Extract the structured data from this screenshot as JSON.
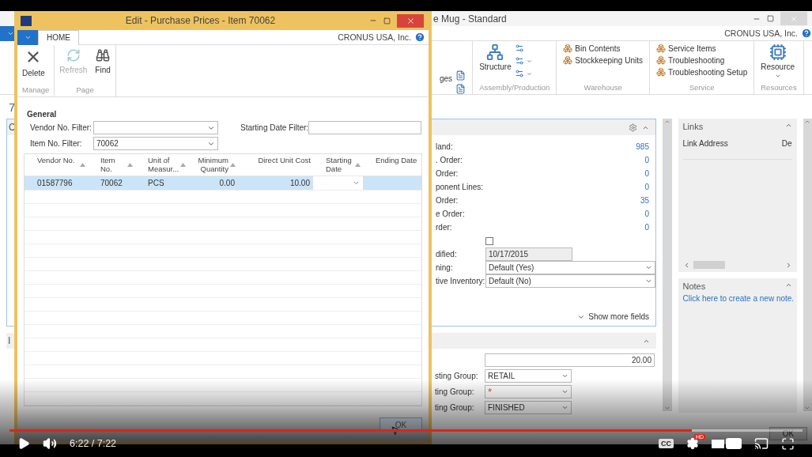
{
  "background_window": {
    "title": "e Mug - Standard",
    "company": "CRONUS USA, Inc.",
    "ribbon": {
      "partial_label": "ges",
      "groups": [
        {
          "name": "Assembly/Production",
          "items": [
            {
              "kind": "large",
              "label": "Structure"
            },
            {
              "kind": "icon",
              "dropdown": false
            },
            {
              "kind": "icon",
              "dropdown": true
            },
            {
              "kind": "icon",
              "dropdown": true
            }
          ]
        },
        {
          "name": "Warehouse",
          "items": [
            {
              "kind": "small",
              "label": "Bin Contents"
            },
            {
              "kind": "small",
              "label": "Stockkeeping Units"
            }
          ]
        },
        {
          "name": "Service",
          "items": [
            {
              "kind": "small",
              "label": "Service Items"
            },
            {
              "kind": "small",
              "label": "Troubleshooting"
            },
            {
              "kind": "small",
              "label": "Troubleshooting Setup"
            }
          ]
        },
        {
          "name": "Resources",
          "items": [
            {
              "kind": "large",
              "label": "Resource",
              "dropdown": true
            }
          ]
        }
      ]
    },
    "left_edge": {
      "page_title": "7",
      "tab_caption": "C",
      "section_caption": "I"
    },
    "main_fields": [
      {
        "kind": "link",
        "label": "land:",
        "value": "985"
      },
      {
        "kind": "link",
        "label": ". Order:",
        "value": "0"
      },
      {
        "kind": "link",
        "label": "Order:",
        "value": "0"
      },
      {
        "kind": "link",
        "label": "ponent Lines:",
        "value": "0"
      },
      {
        "kind": "link",
        "label": "Order:",
        "value": "35"
      },
      {
        "kind": "link",
        "label": "e Order:",
        "value": "0"
      },
      {
        "kind": "link",
        "label": "rder:",
        "value": "0"
      },
      {
        "kind": "checkbox",
        "checked": false
      },
      {
        "kind": "readonly",
        "label": "dified:",
        "value": "10/17/2015"
      },
      {
        "kind": "select",
        "label": "ning:",
        "value": "Default (Yes)"
      },
      {
        "kind": "select",
        "label": "tive Inventory:",
        "value": "Default (No)"
      }
    ],
    "show_more": "Show more fields",
    "second_fields": [
      {
        "kind": "number",
        "value": "20.00"
      },
      {
        "kind": "select",
        "label": "sting Group:",
        "value": "RETAIL"
      },
      {
        "kind": "required",
        "label": "ting Group:",
        "value": "*"
      },
      {
        "kind": "select",
        "label": "ting Group:",
        "value": "FINISHED"
      }
    ],
    "links": {
      "title": "Links",
      "column_1": "Link Address",
      "column_2": "De"
    },
    "notes": {
      "title": "Notes",
      "link": "Click here to create a new note."
    },
    "ok_button": "OK"
  },
  "dialog": {
    "title": "Edit - Purchase Prices - Item 70062",
    "tabs": [
      {
        "label": "HOME",
        "selected": true
      }
    ],
    "company": "CRONUS USA, Inc.",
    "groups": [
      {
        "label": "Manage",
        "actions": [
          {
            "label": "Delete",
            "disabled": false
          }
        ]
      },
      {
        "label": "Page",
        "actions": [
          {
            "label": "Refresh",
            "disabled": true
          },
          {
            "label": "Find",
            "disabled": false
          }
        ]
      }
    ],
    "section": "General",
    "filters_left": [
      {
        "label": "Vendor No. Filter:",
        "kind": "select"
      },
      {
        "label": "Item No. Filter:",
        "kind": "select",
        "value": "70062"
      }
    ],
    "filters_right": [
      {
        "label": "Starting Date Filter:",
        "kind": "text"
      }
    ],
    "columns": [
      {
        "label": "Vendor No.",
        "sort_arrow": true,
        "numeric": false
      },
      {
        "label": "Item No.",
        "sort_arrow": true,
        "numeric": false
      },
      {
        "label": "Unit of Measur...",
        "sort_arrow": true,
        "numeric": false
      },
      {
        "label": "Minimum Quantity",
        "sort_arrow": true,
        "numeric": true
      },
      {
        "label": "Direct Unit Cost",
        "sort_arrow": false,
        "numeric": true
      },
      {
        "label": "Starting Date",
        "sort_arrow": true,
        "numeric": false
      },
      {
        "label": "Ending Date",
        "sort_arrow": false,
        "numeric": false
      }
    ],
    "rows": [
      {
        "cells": [
          "01587796",
          "70062",
          "PCS",
          "0.00",
          "10.00"
        ],
        "selected": true
      }
    ],
    "ok_button": "OK"
  },
  "video": {
    "time": "6:22 / 7:22",
    "progress": {
      "level": 0.86
    },
    "captions_label": "CC",
    "quality_badge": "HD"
  }
}
